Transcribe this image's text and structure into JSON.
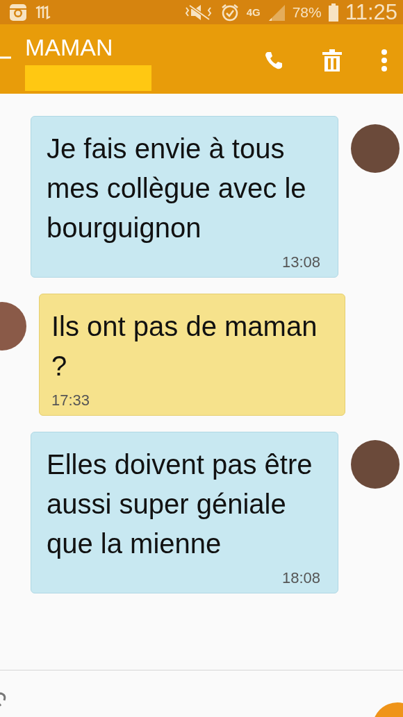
{
  "status_bar": {
    "network": "4G",
    "battery": "78%",
    "time": "11:25"
  },
  "header": {
    "title": "MAMAN"
  },
  "messages": [
    {
      "kind": "sent",
      "text": "Je fais envie à tous mes collègue avec le bourguignon",
      "time": "13:08"
    },
    {
      "kind": "received",
      "text": "Ils ont pas de maman ?",
      "time": "17:33"
    },
    {
      "kind": "sent",
      "text": "Elles doivent pas être aussi super géniale que la mienne",
      "time": "18:08"
    }
  ]
}
